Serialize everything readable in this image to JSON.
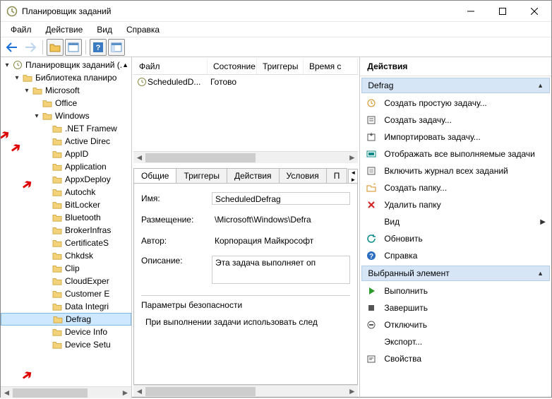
{
  "window": {
    "title": "Планировщик заданий"
  },
  "menu": {
    "file": "Файл",
    "action": "Действие",
    "view": "Вид",
    "help": "Справка"
  },
  "tree": {
    "root": "Планировщик заданий (.",
    "lib": "Библиотека планиро",
    "microsoft": "Microsoft",
    "office": "Office",
    "windows": "Windows",
    "items": [
      ".NET Framew",
      "Active Direc",
      "AppID",
      "Application",
      "AppxDeploy",
      "Autochk",
      "BitLocker",
      "Bluetooth",
      "BrokerInfras",
      "CertificateS",
      "Chkdsk",
      "Clip",
      "CloudExper",
      "Customer E",
      "Data Integri",
      "Defrag",
      "Device Info",
      "Device Setu"
    ],
    "selected_index": 15
  },
  "task_list": {
    "columns": {
      "file": "Файл",
      "state": "Состояние",
      "triggers": "Триггеры",
      "time": "Время с"
    },
    "rows": [
      {
        "name": "ScheduledD...",
        "state": "Готово"
      }
    ]
  },
  "detail_tabs": {
    "general": "Общие",
    "triggers": "Триггеры",
    "actions": "Действия",
    "conditions": "Условия",
    "more": "П"
  },
  "details": {
    "name_label": "Имя:",
    "name_value": "ScheduledDefrag",
    "location_label": "Размещение:",
    "location_value": "\\Microsoft\\Windows\\Defra",
    "author_label": "Автор:",
    "author_value": "Корпорация Майкрософт",
    "desc_label": "Описание:",
    "desc_value": "Эта задача выполняет оп",
    "sec_label": "Параметры безопасности",
    "sec_text": "При выполнении задачи использовать след"
  },
  "actions": {
    "title": "Действия",
    "group1": "Defrag",
    "group2": "Выбранный элемент",
    "items1": [
      "Создать простую задачу...",
      "Создать задачу...",
      "Импортировать задачу...",
      "Отображать все выполняемые задачи",
      "Включить журнал всех заданий",
      "Создать папку...",
      "Удалить папку",
      "Вид",
      "Обновить",
      "Справка"
    ],
    "items2": [
      "Выполнить",
      "Завершить",
      "Отключить",
      "Экспорт...",
      "Свойства"
    ]
  }
}
